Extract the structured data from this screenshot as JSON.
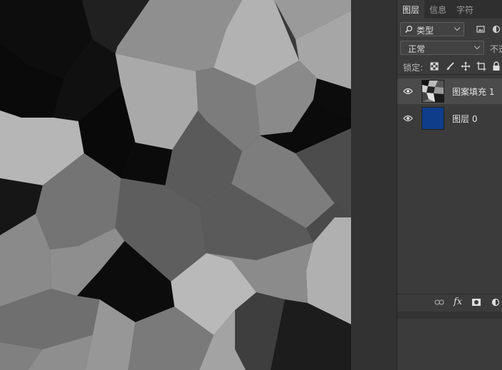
{
  "panel": {
    "tabs": [
      {
        "label": "图层",
        "active": true
      },
      {
        "label": "信息",
        "active": false
      },
      {
        "label": "字符",
        "active": false
      }
    ],
    "filter": {
      "search_icon": "search-icon",
      "label": "类型"
    },
    "blend_mode": "正常",
    "opacity_label": "不透",
    "lock_label": "锁定:",
    "layers": [
      {
        "name": "图案填充 1",
        "visible": true,
        "selected": true,
        "thumb": "pattern-thumbnail"
      },
      {
        "name": "图层 0",
        "visible": true,
        "selected": false,
        "thumb_color": "#0f3d8a"
      }
    ],
    "bottom_icons": [
      "link-icon",
      "fx-icon",
      "mask-icon",
      "adjustment-icon"
    ],
    "fx_label": "fx"
  },
  "colors": {
    "panel_bg": "#3b3b3b",
    "selected_row": "#4b4b4b",
    "layer0_fill": "#0f3d8a"
  }
}
